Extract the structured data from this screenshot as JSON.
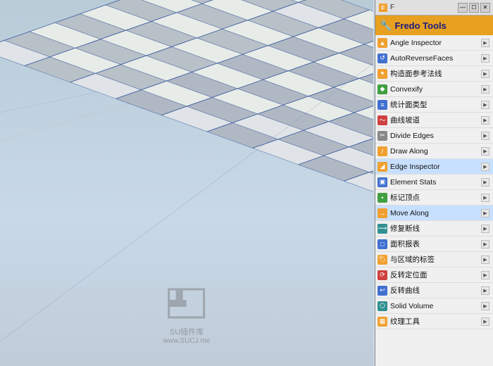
{
  "panel": {
    "titlebar": {
      "icon": "🔧",
      "name": "F",
      "controls": [
        "—",
        "☐",
        "✕"
      ]
    },
    "title": "Fredo Tools",
    "menu_items": [
      {
        "id": "angle-inspector",
        "label": "Angle Inspector",
        "icon": "▲",
        "icon_type": "triangle-orange"
      },
      {
        "id": "auto-reverse-faces",
        "label": "AutoReverseFaces",
        "icon": "↺",
        "icon_type": "arrow-blue"
      },
      {
        "id": "construct-face",
        "label": "构造面参考法线",
        "icon": "✦",
        "icon_type": "star-orange"
      },
      {
        "id": "convexify",
        "label": "Convexify",
        "icon": "◆",
        "icon_type": "diamond-green"
      },
      {
        "id": "count-face-types",
        "label": "统计面类型",
        "icon": "≡",
        "icon_type": "lines-blue"
      },
      {
        "id": "curve-channel",
        "label": "曲线坡道",
        "icon": "〜",
        "icon_type": "wave-red"
      },
      {
        "id": "divide-edges",
        "label": "Divide Edges",
        "icon": "✂",
        "icon_type": "scissors-gray"
      },
      {
        "id": "draw-along",
        "label": "Draw Along",
        "icon": "/",
        "icon_type": "slash-orange"
      },
      {
        "id": "edge-inspector",
        "label": "Edge Inspector",
        "icon": "◢",
        "icon_type": "corner-orange",
        "highlighted": true
      },
      {
        "id": "element-stats",
        "label": "Element Stats",
        "icon": "📊",
        "icon_type": "chart-blue"
      },
      {
        "id": "mark-vertices",
        "label": "标记顶点",
        "icon": "•",
        "icon_type": "dot-green"
      },
      {
        "id": "move-along",
        "label": "Move Along",
        "icon": "→",
        "icon_type": "arrow-right-orange",
        "highlighted": true
      },
      {
        "id": "repair-breaks",
        "label": "修复断线",
        "icon": "⟿",
        "icon_type": "arrow-teal"
      },
      {
        "id": "area-report",
        "label": "面积报表",
        "icon": "□",
        "icon_type": "square-blue"
      },
      {
        "id": "area-tags",
        "label": "与区域的标签",
        "icon": "🏷",
        "icon_type": "tag-orange"
      },
      {
        "id": "reverse-orient",
        "label": "反转定位面",
        "icon": "⟳",
        "icon_type": "refresh-red"
      },
      {
        "id": "reverse-curve",
        "label": "反转曲线",
        "icon": "↩",
        "icon_type": "undo-blue"
      },
      {
        "id": "solid-volume",
        "label": "Solid Volume",
        "icon": "⬡",
        "icon_type": "hex-teal"
      },
      {
        "id": "texture-tool",
        "label": "纹理工具",
        "icon": "▦",
        "icon_type": "grid-orange"
      }
    ],
    "arrow_label": "▶"
  },
  "viewport": {
    "watermark_text": "SU插件库",
    "watermark_url": "www.SUCJ.me"
  }
}
